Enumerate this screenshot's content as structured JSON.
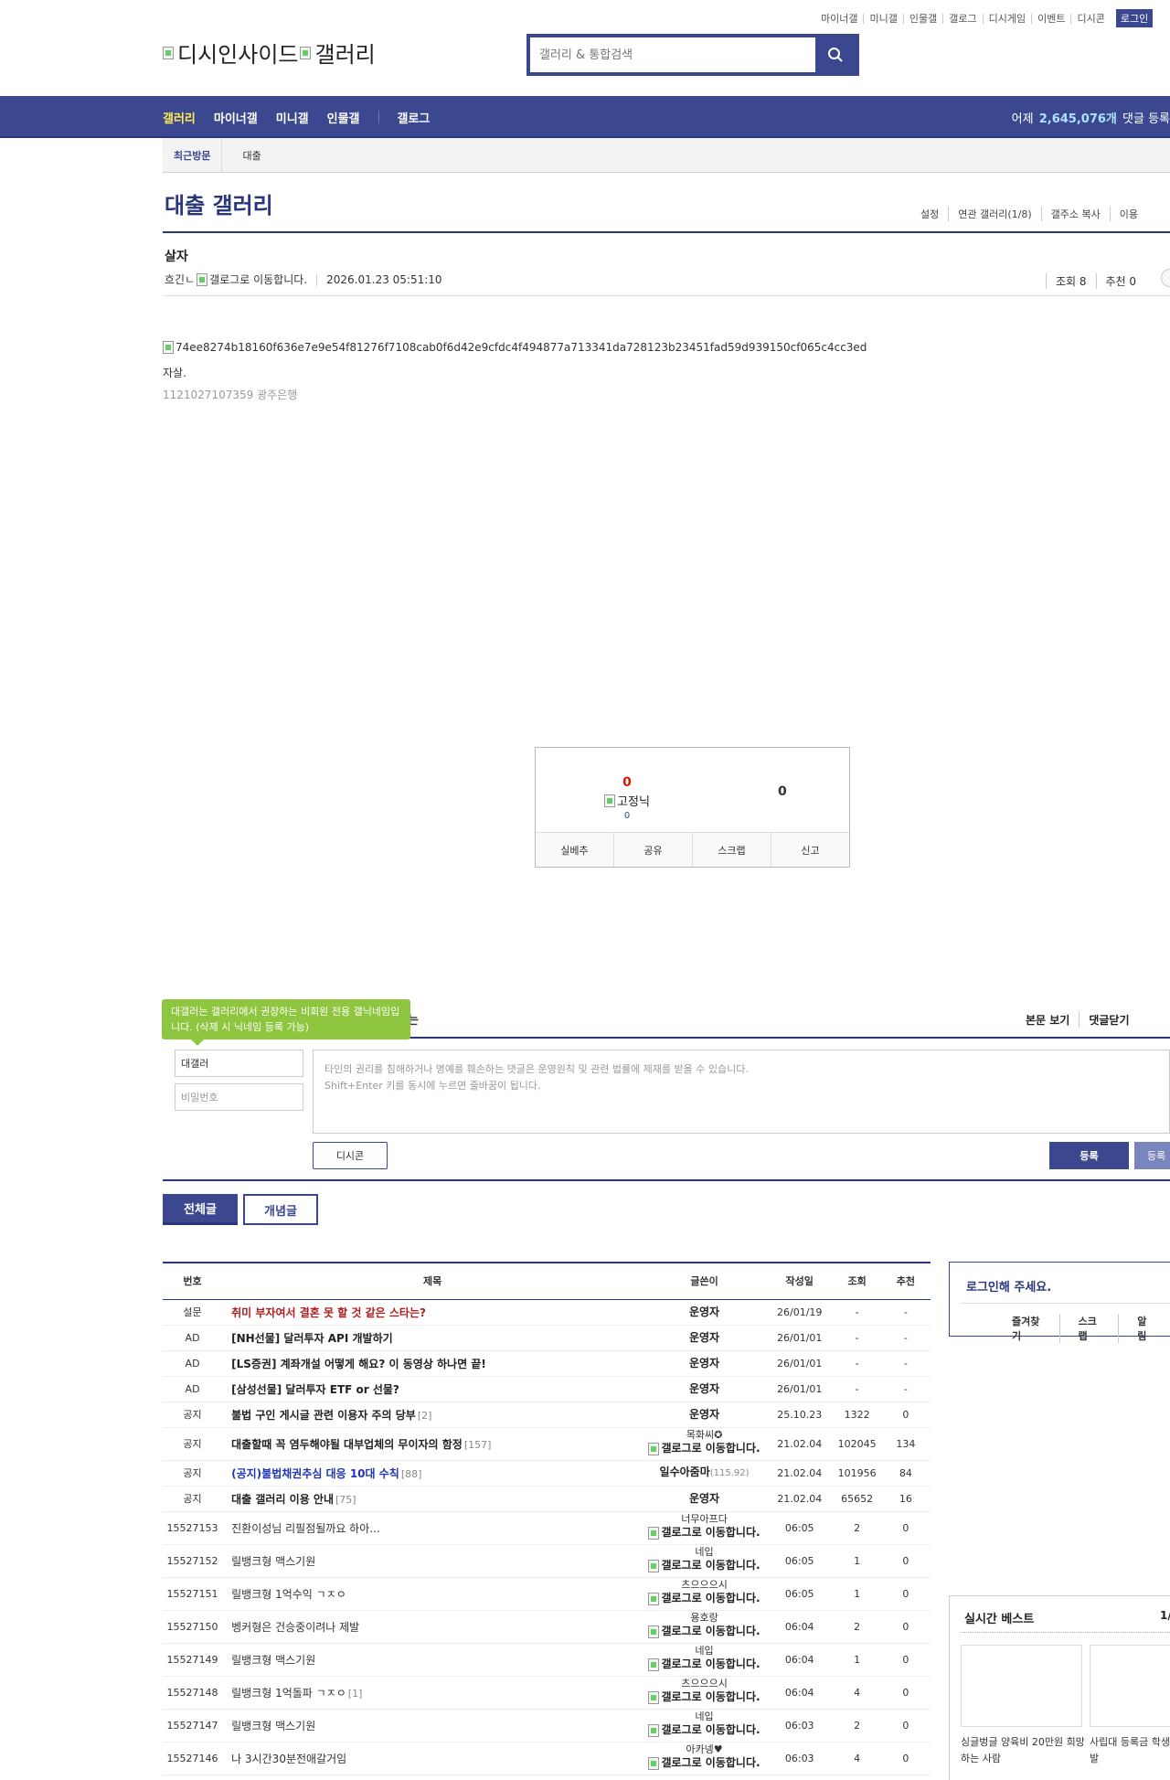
{
  "top_links": [
    "마이너갤",
    "미니갤",
    "인물갤",
    "갤로그",
    "디시게임",
    "이벤트",
    "디시콘"
  ],
  "login_button": "로그인",
  "logo": {
    "site": "디시인사이드",
    "section": "갤러리"
  },
  "search": {
    "placeholder": "갤러리 & 통합검색"
  },
  "gnb": {
    "items": [
      "갤러리",
      "마이너갤",
      "미니갤",
      "인물갤",
      "갤로그"
    ],
    "stat_prefix": "어제",
    "stat_value": "2,645,076개",
    "stat_suffix": "댓글 등록"
  },
  "subnav": {
    "recent": "최근방문",
    "gallery": "대출"
  },
  "gallery": {
    "title": "대출 갤러리",
    "tools": [
      "설정",
      "연관 갤러리(1/8)",
      "갤주소 복사",
      "이용"
    ]
  },
  "post": {
    "title": "살자",
    "author": "흐긴ㄴ",
    "gallog_alt": "갤로그로 이동합니다.",
    "date": "2026.01.23 05:51:10",
    "views": "조회 8",
    "recommend": "추천 0",
    "image_alt": "74ee8274b18160f636e7e9e54f81276f7108cab0f6d42e9cfdc4f494877a713341da728123b23451fad59d939150cf065c4cc3ed",
    "text": "자살.",
    "subtext": "1121027107359 광주은행"
  },
  "reco": {
    "up_count": "0",
    "fix_label": "고정닉",
    "fix_count": "0",
    "down_count": "0",
    "buttons": [
      "실베추",
      "공유",
      "스크랩",
      "신고"
    ]
  },
  "comment": {
    "tip": "대갤러는 갤러리에서 권장하는 비회원 전용 갤닉네임입니다. (삭제 시 닉네임 등록 가능)",
    "head_fragment": "는",
    "links": [
      "본문 보기",
      "댓글닫기"
    ],
    "nick": "대갤러",
    "password_placeholder": "비밀번호",
    "box_line1": "타인의 권리를 침해하거나 명예를 훼손하는 댓글은 운영원칙 및 관련 법률에 제재를 받을 수 있습니다.",
    "box_line2": "Shift+Enter 키를 동시에 누르면 줄바꿈이 됩니다.",
    "dccon": "디시콘",
    "submit": "등록",
    "submit2": "등록"
  },
  "tabs": {
    "all": "전체글",
    "concept": "개념글"
  },
  "table": {
    "headers": [
      "번호",
      "제목",
      "글쓴이",
      "작성일",
      "조회",
      "추천"
    ],
    "gallog_alt": "갤로그로 이동합니다.",
    "rows": [
      {
        "no": "설문",
        "subject": "취미 부자여서 결혼 못 할 것 같은 스타는?",
        "style": "red",
        "writer": "운영자",
        "date": "26/01/19",
        "views": "-",
        "rec": "-"
      },
      {
        "no": "AD",
        "subject": "[NH선물] 달러투자 API 개발하기",
        "style": "b",
        "writer": "운영자",
        "date": "26/01/01",
        "views": "-",
        "rec": "-"
      },
      {
        "no": "AD",
        "subject": "[LS증권] 계좌개설 어떻게 해요? 이 동영상 하나면 끝!",
        "style": "b",
        "writer": "운영자",
        "date": "26/01/01",
        "views": "-",
        "rec": "-"
      },
      {
        "no": "AD",
        "subject": "[삼성선물] 달러투자 ETF or 선물?",
        "style": "b",
        "writer": "운영자",
        "date": "26/01/01",
        "views": "-",
        "rec": "-"
      },
      {
        "no": "공지",
        "subject": "불법 구인 게시글 관련 이용자 주의 당부",
        "count": "[2]",
        "style": "b",
        "writer": "운영자",
        "date": "25.10.23",
        "views": "1322",
        "rec": "0"
      },
      {
        "no": "공지",
        "subject": "대출할때 꼭 염두해야될 대부업체의 무이자의 함정",
        "count": "[157]",
        "style": "b",
        "writer_nick": "목화씨✪",
        "writer_gallog": true,
        "date": "21.02.04",
        "views": "102045",
        "rec": "134"
      },
      {
        "no": "공지",
        "subject": "(공지)불법채권추심 대응 10대 수칙",
        "count": "[88]",
        "style": "blue",
        "writer_ip": "일수아줌마",
        "ip": "(115.92)",
        "date": "21.02.04",
        "views": "101956",
        "rec": "84"
      },
      {
        "no": "공지",
        "subject": "대출 갤러리 이용 안내",
        "count": "[75]",
        "style": "b",
        "writer": "운영자",
        "date": "21.02.04",
        "views": "65652",
        "rec": "16"
      },
      {
        "no": "15527153",
        "subject": "진환이성님 리필점될까요 하아...",
        "writer_nick": "너무아프다",
        "writer_gallog": true,
        "date": "06:05",
        "views": "2",
        "rec": "0"
      },
      {
        "no": "15527152",
        "subject": "릴뱅크형 맥스기원",
        "writer_nick": "네입",
        "writer_gallog": true,
        "date": "06:05",
        "views": "1",
        "rec": "0"
      },
      {
        "no": "15527151",
        "subject": "릴뱅크형 1억수익 ㄱㅈㅇ",
        "writer_nick": "츠으으으시",
        "writer_gallog": true,
        "date": "06:05",
        "views": "1",
        "rec": "0"
      },
      {
        "no": "15527150",
        "subject": "벵커형은 건승중이려나 제발",
        "writer_nick": "용호랑",
        "writer_gallog": true,
        "date": "06:04",
        "views": "2",
        "rec": "0"
      },
      {
        "no": "15527149",
        "subject": "릴뱅크형 맥스기원",
        "writer_nick": "네입",
        "writer_gallog": true,
        "date": "06:04",
        "views": "1",
        "rec": "0"
      },
      {
        "no": "15527148",
        "subject": "릴뱅크형 1억돌파 ㄱㅈㅇ",
        "count": "[1]",
        "writer_nick": "츠으으으시",
        "writer_gallog": true,
        "date": "06:04",
        "views": "4",
        "rec": "0"
      },
      {
        "no": "15527147",
        "subject": "릴뱅크형 맥스기원",
        "writer_nick": "네입",
        "writer_gallog": true,
        "date": "06:03",
        "views": "2",
        "rec": "0"
      },
      {
        "no": "15527146",
        "subject": "나 3시간30분전애갈거임",
        "writer_nick": "아카넹♥",
        "writer_gallog": true,
        "date": "06:03",
        "views": "4",
        "rec": "0"
      }
    ]
  },
  "login_box": {
    "title": "로그인해 주세요.",
    "links": [
      "즐겨찾기",
      "스크랩",
      "알림"
    ]
  },
  "best": {
    "title": "실시간 베스트",
    "page": "1/",
    "items": [
      {
        "caption": "싱글벙글 양육비 20만원 희망하는 사람"
      },
      {
        "caption": "사립대 등록금 학생들, 거센 반발"
      }
    ]
  }
}
